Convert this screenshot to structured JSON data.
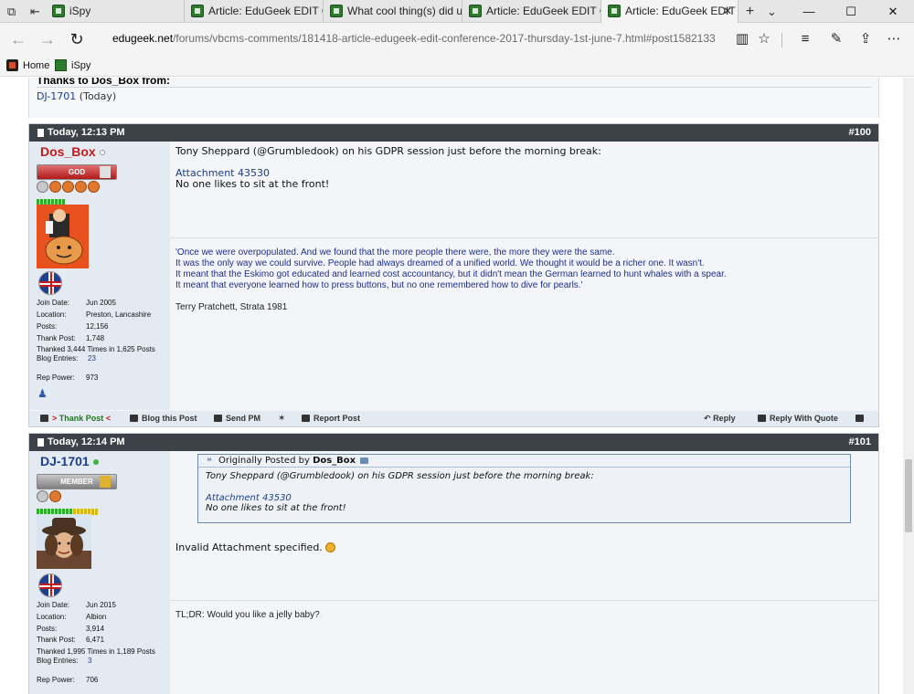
{
  "browser": {
    "tabs": [
      {
        "title": "iSpy"
      },
      {
        "title": "Article: EduGeek EDIT Confe"
      },
      {
        "title": "What cool thing(s) did u do"
      },
      {
        "title": "Article: EduGeek EDIT Confe"
      },
      {
        "title": "Article: EduGeek EDIT C",
        "active": true
      }
    ],
    "url_host": "edugeek.net",
    "url_path": "/forums/vbcms-comments/181418-article-edugeek-edit-conference-2017-thursday-1st-june-7.html#post1582133",
    "favorites": [
      "Home",
      "iSpy"
    ]
  },
  "prev_thanks": {
    "heading": "Thanks to Dos_Box from:",
    "user": "DJ-1701",
    "when": "(Today)"
  },
  "posts": [
    {
      "date": "Today, 12:13 PM",
      "number": "#100",
      "username": "Dos_Box",
      "rank": "GOD",
      "stats": {
        "join_date_label": "Join Date:",
        "join_date": "Jun 2005",
        "location_label": "Location:",
        "location": "Preston, Lancashire",
        "posts_label": "Posts:",
        "posts": "12,156",
        "thank_post_label": "Thank Post:",
        "thank_post": "1,748",
        "thanked": "Thanked 3,444 Times in 1,625 Posts",
        "blog_label": "Blog Entries:",
        "blog": "23",
        "rep_power_label": "Rep Power:",
        "rep_power": "973"
      },
      "message_line1": "Tony Sheppard (@Grumbledook) on his GDPR session just before the morning break:",
      "attachment": "Attachment 43530",
      "message_line2": "No one likes to sit at the front!",
      "signature": [
        "'Once we were overpopulated. And we found that the more people there were, the more they were the same.",
        "It was the only way we could survive. People had always dreamed of a unified world. We thought it would be a richer one. It wasn't.",
        "It meant that the Eskimo got educated and learned cost accountancy, but it didn't mean the German learned to hunt whales with a spear.",
        "It meant that everyone learned how to press buttons, but no one remembered how to dive for pearls.'"
      ],
      "signature_credit": "Terry Pratchett, Strata 1981",
      "toolbar": {
        "thank_pre": ">",
        "thank": "Thank Post",
        "thank_post": "<",
        "blog": "Blog this Post",
        "pm": "Send PM",
        "report": "Report Post",
        "reply": "Reply",
        "reply_quote": "Reply With Quote"
      }
    },
    {
      "date": "Today, 12:14 PM",
      "number": "#101",
      "username": "DJ-1701",
      "rank": "MEMBER",
      "stats": {
        "join_date_label": "Join Date:",
        "join_date": "Jun 2015",
        "location_label": "Location:",
        "location": "Albion",
        "posts_label": "Posts:",
        "posts": "3,914",
        "thank_post_label": "Thank Post:",
        "thank_post": "6,471",
        "thanked": "Thanked 1,995 Times in 1,189 Posts",
        "blog_label": "Blog Entries:",
        "blog": "3",
        "rep_power_label": "Rep Power:",
        "rep_power": "706"
      },
      "quote": {
        "prefix": "Originally Posted by",
        "author": "Dos_Box",
        "line1": "Tony Sheppard (@Grumbledook) on his GDPR session just before the morning break:",
        "attachment": "Attachment 43530",
        "line2": "No one likes to sit at the front!"
      },
      "message": "Invalid Attachment specified.",
      "signature": "TL;DR: Would you like a jelly baby?"
    }
  ],
  "colors": {
    "header_bar": "#3c4248",
    "userinfo_bg": "#e3eaf1",
    "username_red": "#c21b1b",
    "link_blue": "#1b3f8b",
    "signature_blue": "#1f2f8a"
  }
}
